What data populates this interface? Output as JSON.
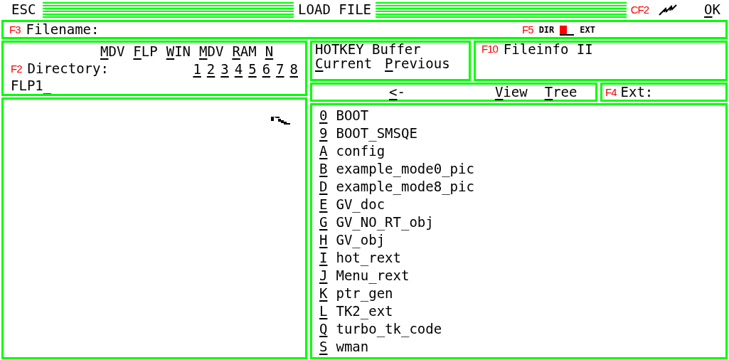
{
  "title_bar": {
    "left_button": "ESC",
    "title": "LOAD FILE",
    "key_label": "CF2",
    "right_button": "OK"
  },
  "filename": {
    "key": "F3",
    "label": "Filename:",
    "toggle_key": "F5",
    "options": [
      {
        "label": "DIR",
        "selected": true
      },
      {
        "label": "EXT",
        "selected": false
      }
    ]
  },
  "directory": {
    "devices": [
      "MDV",
      "FLP",
      "WIN",
      "MDV",
      "RAM",
      "N"
    ],
    "key": "F2",
    "label": "Directory:",
    "numbers": [
      "1",
      "2",
      "3",
      "4",
      "5",
      "6",
      "7",
      "8"
    ],
    "value": "FLP1_"
  },
  "hotkey_buffer": {
    "title": "HOTKEY Buffer",
    "buttons": [
      "Current",
      "Previous"
    ]
  },
  "fileinfo": {
    "key": "F10",
    "label": "Fileinfo II"
  },
  "nav": {
    "back": "<-",
    "view": "View",
    "tree": "Tree"
  },
  "ext": {
    "key": "F4",
    "label": "Ext:"
  },
  "files": [
    {
      "key": "0",
      "name": "BOOT"
    },
    {
      "key": "9",
      "name": "BOOT_SMSQE"
    },
    {
      "key": "A",
      "name": "config"
    },
    {
      "key": "B",
      "name": "example_mode0_pic"
    },
    {
      "key": "D",
      "name": "example_mode8_pic"
    },
    {
      "key": "E",
      "name": "GV_doc"
    },
    {
      "key": "G",
      "name": "GV_NO_RT_obj"
    },
    {
      "key": "H",
      "name": "GV_obj"
    },
    {
      "key": "I",
      "name": "hot_rext"
    },
    {
      "key": "J",
      "name": "Menu_rext"
    },
    {
      "key": "K",
      "name": "ptr_gen"
    },
    {
      "key": "L",
      "name": "TK2_ext"
    },
    {
      "key": "Q",
      "name": "turbo_tk_code"
    },
    {
      "key": "S",
      "name": "wman"
    }
  ]
}
